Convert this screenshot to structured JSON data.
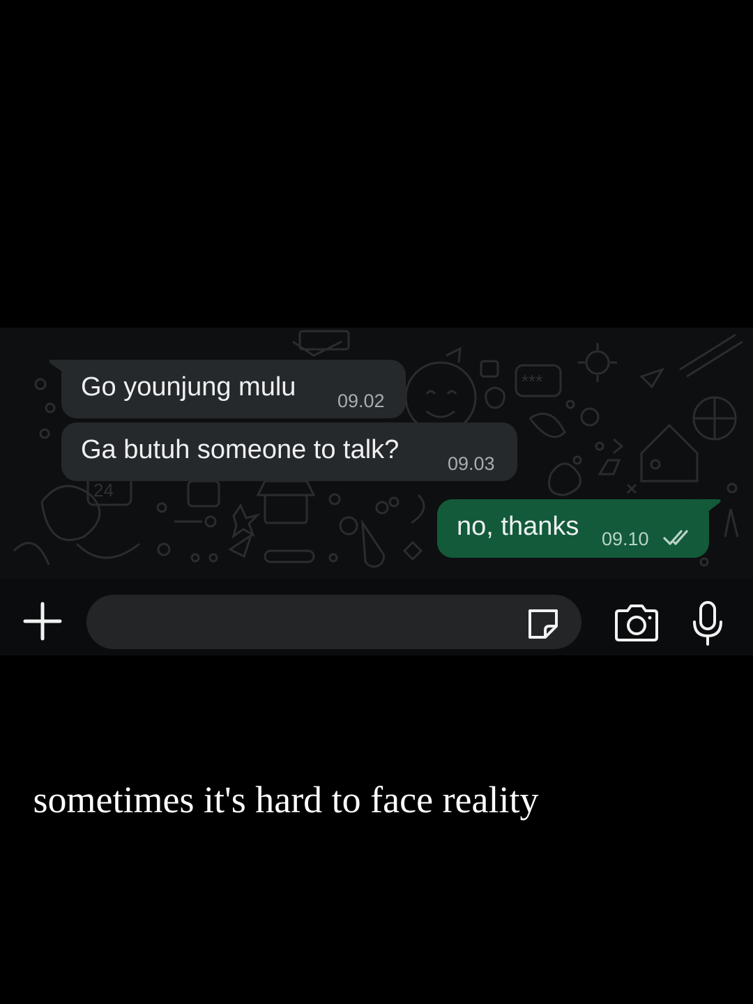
{
  "chat": {
    "messages": [
      {
        "direction": "incoming",
        "text": "Go younjung mulu",
        "time": "09.02"
      },
      {
        "direction": "incoming",
        "text": "Ga butuh someone to talk?",
        "time": "09.03"
      },
      {
        "direction": "outgoing",
        "text": "no, thanks",
        "time": "09.10",
        "status": "read",
        "status_icon": "double-check-icon"
      }
    ]
  },
  "composer": {
    "input_value": "",
    "placeholder": "",
    "icons": {
      "attach": "plus-icon",
      "sticker": "sticker-icon",
      "camera": "camera-icon",
      "voice": "microphone-icon"
    }
  },
  "caption": {
    "text": "sometimes it's hard to face reality"
  },
  "colors": {
    "background": "#000000",
    "incoming_bubble": "#26292c",
    "outgoing_bubble": "#125a3a",
    "composer_input": "#232527"
  }
}
